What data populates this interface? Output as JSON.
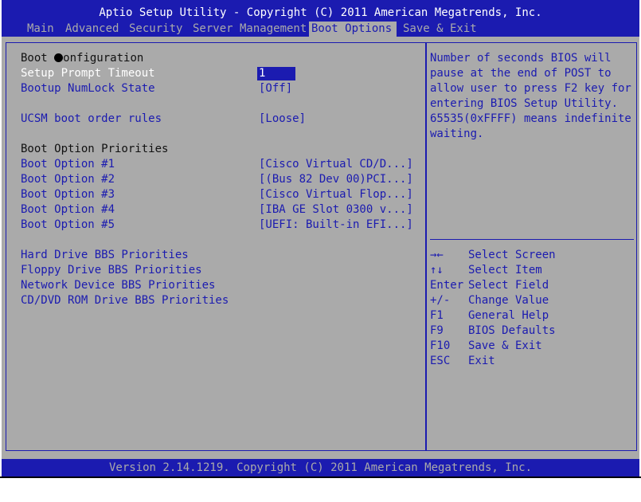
{
  "title": "Aptio Setup Utility - Copyright (C) 2011 American Megatrends, Inc.",
  "menu": {
    "main": "Main",
    "advanced": "Advanced",
    "security": "Security",
    "server_management": "Server Management",
    "boot_options": "Boot Options",
    "save_exit": "Save & Exit",
    "active": "Boot Options"
  },
  "left": {
    "boot_config_prefix": "Boot ",
    "boot_config_suffix": "onfiguration",
    "setup_prompt_timeout": {
      "label": "Setup Prompt Timeout",
      "value": "1"
    },
    "bootup_numlock": {
      "label": "Bootup NumLock State",
      "value": "[Off]"
    },
    "ucsm_boot_order": {
      "label": "UCSM boot order rules",
      "value": "[Loose]"
    },
    "priorities_heading": "Boot Option Priorities",
    "boot_options": [
      {
        "label": "Boot Option #1",
        "value": "[Cisco Virtual CD/D...]"
      },
      {
        "label": "Boot Option #2",
        "value": "[(Bus 82 Dev 00)PCI...]"
      },
      {
        "label": "Boot Option #3",
        "value": "[Cisco Virtual Flop...]"
      },
      {
        "label": "Boot Option #4",
        "value": "[IBA GE Slot 0300 v...]"
      },
      {
        "label": "Boot Option #5",
        "value": "[UEFI: Built-in EFI...]"
      }
    ],
    "bbs": [
      "Hard Drive BBS Priorities",
      "Floppy Drive BBS Priorities",
      "Network Device BBS Priorities",
      "CD/DVD ROM Drive BBS Priorities"
    ]
  },
  "help": {
    "lines": [
      "Number of seconds BIOS will",
      "pause at the end of POST to",
      "allow user to press F2 key for",
      "entering BIOS Setup Utility.",
      "65535(0xFFFF) means indefinite",
      "waiting."
    ],
    "keys": [
      {
        "key": "→←",
        "desc": "Select Screen"
      },
      {
        "key": "↑↓",
        "desc": "Select Item"
      },
      {
        "key": "Enter",
        "desc": "Select Field"
      },
      {
        "key": "+/-",
        "desc": "Change Value"
      },
      {
        "key": "F1",
        "desc": "General Help"
      },
      {
        "key": "F9",
        "desc": "BIOS Defaults"
      },
      {
        "key": "F10",
        "desc": "Save & Exit"
      },
      {
        "key": "ESC",
        "desc": "Exit"
      }
    ]
  },
  "footer": "Version 2.14.1219. Copyright (C) 2011 American Megatrends, Inc.",
  "colors": {
    "blue": "#1b1bb0",
    "gray": "#aaaaaa",
    "white": "#ffffff"
  }
}
